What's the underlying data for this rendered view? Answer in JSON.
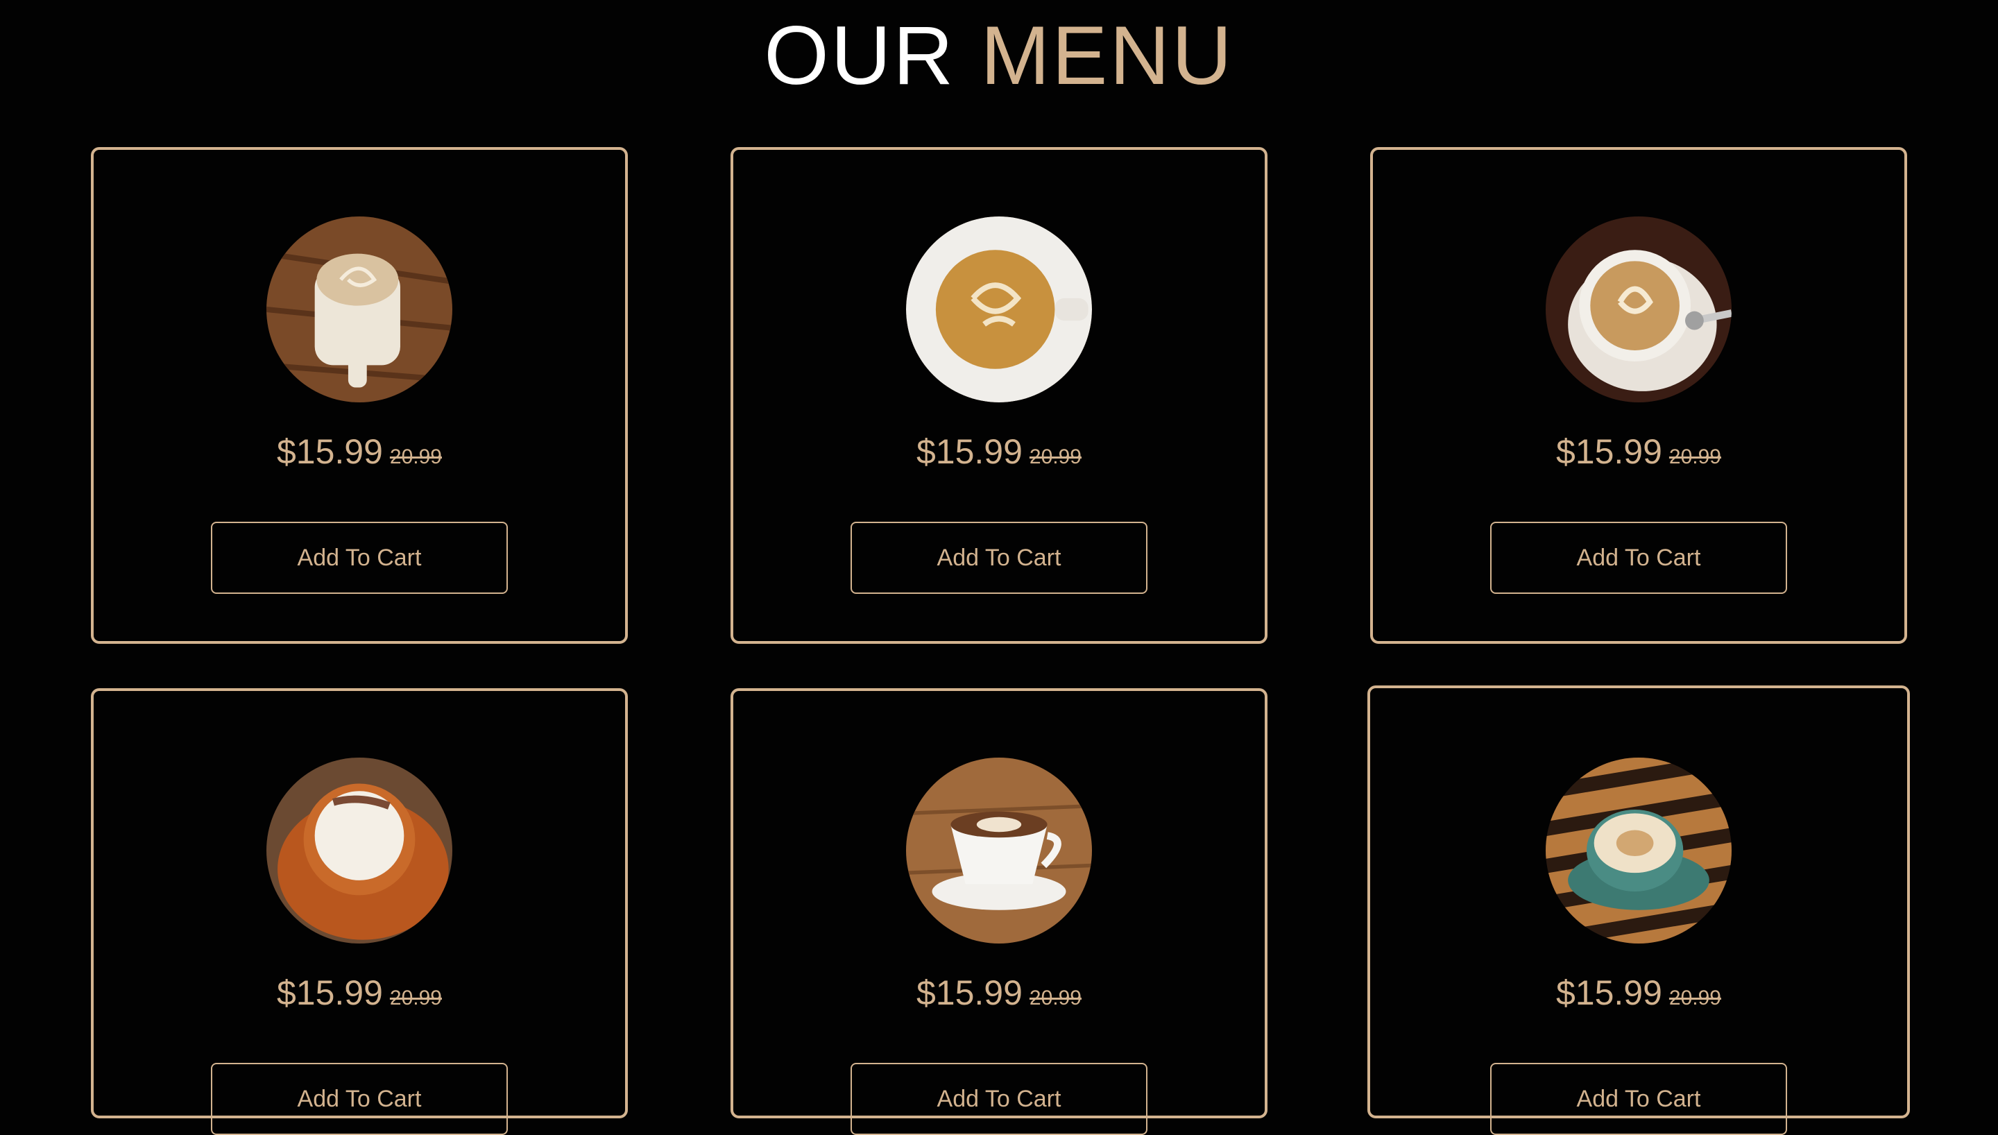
{
  "heading": {
    "first": "OUR",
    "second": "MENU"
  },
  "menu": {
    "items": [
      {
        "price": "$15.99",
        "old_price": "20.99",
        "button": "Add To Cart",
        "image": "latte-on-wood-table"
      },
      {
        "price": "$15.99",
        "old_price": "20.99",
        "button": "Add To Cart",
        "image": "latte-art-cup-top-view"
      },
      {
        "price": "$15.99",
        "old_price": "20.99",
        "button": "Add To Cart",
        "image": "latte-with-spoon"
      },
      {
        "price": "$15.99",
        "old_price": "20.99",
        "button": "Add To Cart",
        "image": "cappuccino-orange-cup"
      },
      {
        "price": "$15.99",
        "old_price": "20.99",
        "button": "Add To Cart",
        "image": "white-cup-on-saucer"
      },
      {
        "price": "$15.99",
        "old_price": "20.99",
        "button": "Add To Cart",
        "image": "teal-cup-on-slats"
      }
    ]
  },
  "colors": {
    "background": "#020202",
    "accent": "#d3b38f",
    "text_light": "#ffffff"
  }
}
